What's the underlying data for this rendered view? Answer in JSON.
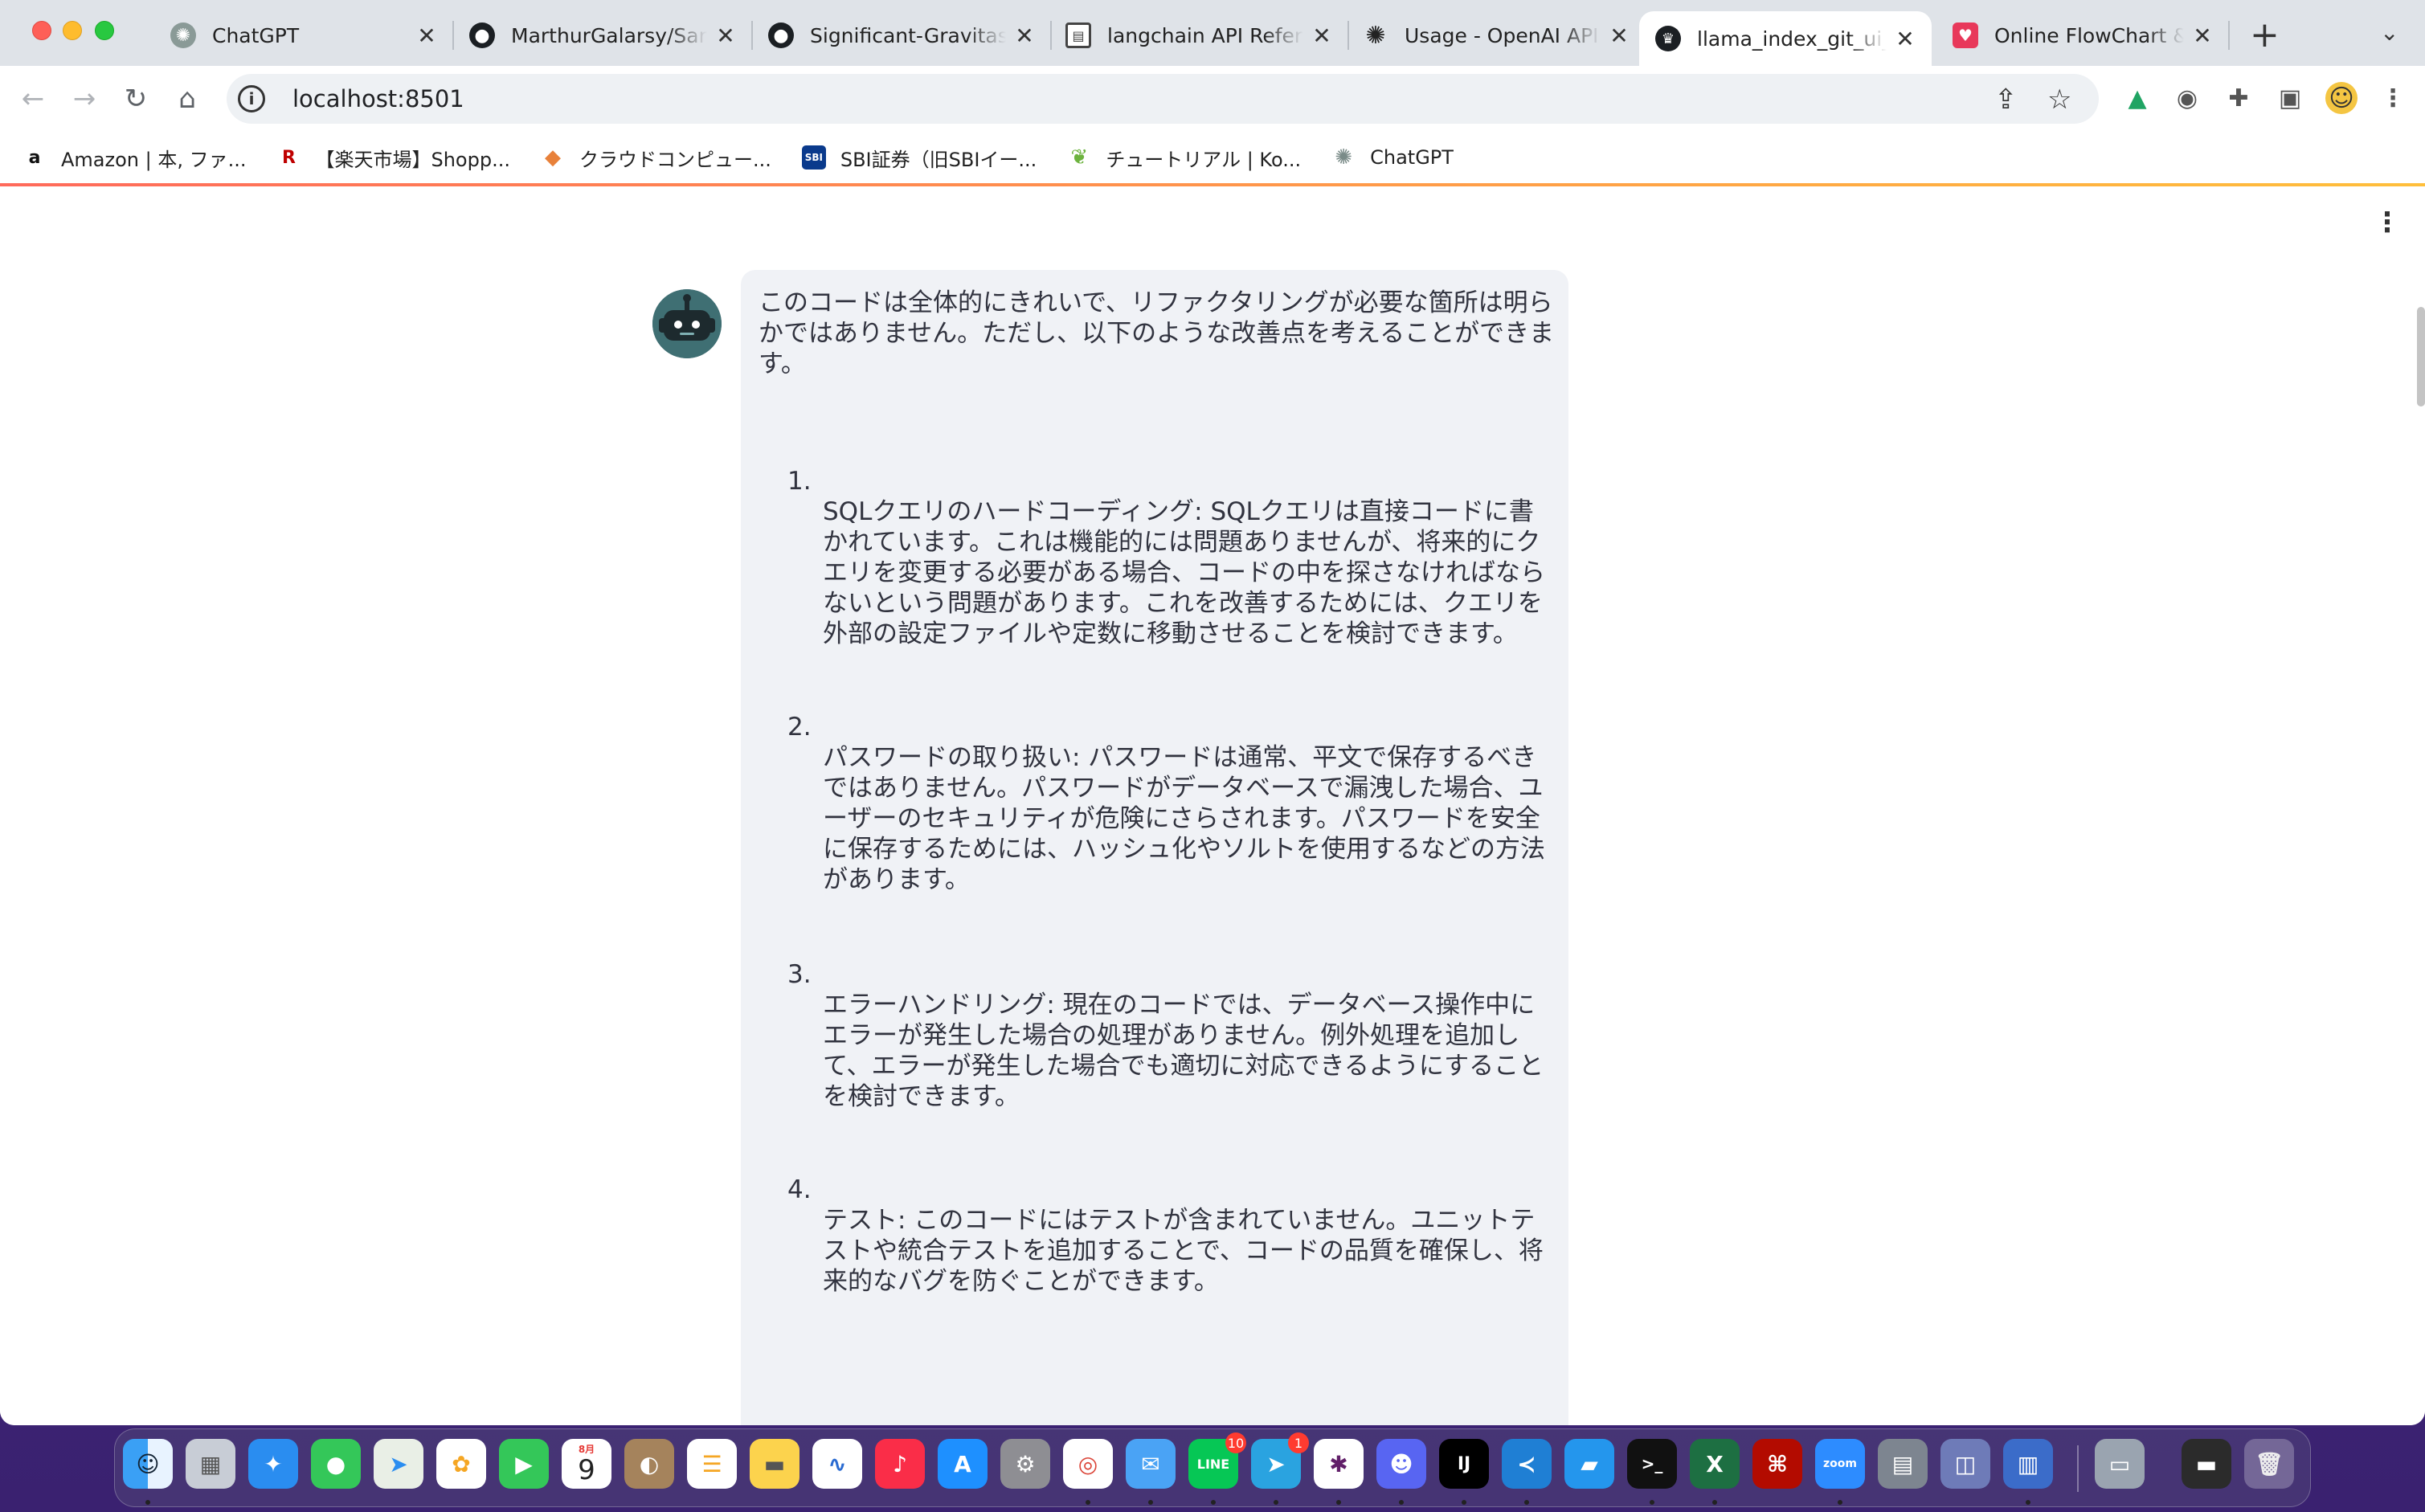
{
  "tabs": [
    {
      "title": "ChatGPT",
      "icon": "chatgpt-icon",
      "color": "#8a9a97"
    },
    {
      "title": "MarthurGalarsy/Samp",
      "icon": "github-icon",
      "color": "#1b1f23"
    },
    {
      "title": "Significant-Gravitas/A",
      "icon": "github-icon",
      "color": "#1b1f23"
    },
    {
      "title": "langchain API Referen",
      "icon": "docs-icon",
      "color": "#444444"
    },
    {
      "title": "Usage - OpenAI API",
      "icon": "openai-icon",
      "color": "#222222"
    },
    {
      "title": "llama_index_git_ui_g",
      "icon": "streamlit-crown-icon",
      "color": "#1b1f23"
    },
    {
      "title": "Online FlowChart & D",
      "icon": "flowchart-icon",
      "color": "#e8385a"
    }
  ],
  "address_bar": {
    "url": "localhost:8501"
  },
  "bookmarks": [
    {
      "label": "Amazon | 本, ファ...",
      "icon": "amazon-icon",
      "glyph": "a",
      "color": "#111111"
    },
    {
      "label": "【楽天市場】Shopp...",
      "icon": "rakuten-icon",
      "glyph": "R",
      "color": "#bf0000"
    },
    {
      "label": "クラウドコンピュー...",
      "icon": "aws-cube-icon",
      "glyph": "■",
      "color": "#e8813a"
    },
    {
      "label": "SBI証券（旧SBIイー...",
      "icon": "sbi-icon",
      "glyph": "SBI",
      "color": "#0a3a8c"
    },
    {
      "label": "チュートリアル | Ko...",
      "icon": "spring-leaf-icon",
      "glyph": "❦",
      "color": "#6db33f"
    },
    {
      "label": "ChatGPT",
      "icon": "chatgpt-icon",
      "glyph": "✺",
      "color": "#7a8b88"
    }
  ],
  "message": {
    "intro": "このコードは全体的にきれいで、リファクタリングが必要な箇所は明らかではありません。ただし、以下のような改善点を考えることができます。",
    "items": [
      {
        "num": "1.",
        "text": "SQLクエリのハードコーディング: SQLクエリは直接コードに書かれています。これは機能的には問題ありませんが、将来的にクエリを変更する必要がある場合、コードの中を探さなければならないという問題があります。これを改善するためには、クエリを外部の設定ファイルや定数に移動させることを検討できます。"
      },
      {
        "num": "2.",
        "text": "パスワードの取り扱い: パスワードは通常、平文で保存するべきではありません。パスワードがデータベースで漏洩した場合、ユーザーのセキュリティが危険にさらされます。パスワードを安全に保存するためには、ハッシュ化やソルトを使用するなどの方法があります。"
      },
      {
        "num": "3.",
        "text": "エラーハンドリング: 現在のコードでは、データベース操作中にエラーが発生した場合の処理がありません。例外処理を追加して、エラーが発生した場合でも適切に対応できるようにすることを検討できます。"
      },
      {
        "num": "4.",
        "text": "テスト: このコードにはテストが含まれていません。ユニットテストや統合テストを追加することで、コードの品質を確保し、将来的なバグを防ぐことができます。"
      }
    ]
  },
  "dock": {
    "calendar_month": "8月",
    "calendar_day": "9",
    "line_badge": "10",
    "telegram_badge": "1",
    "line_label": "LINE",
    "zoom_label": "zoom",
    "intellij_label": "IJ",
    "excel_label": "X"
  }
}
